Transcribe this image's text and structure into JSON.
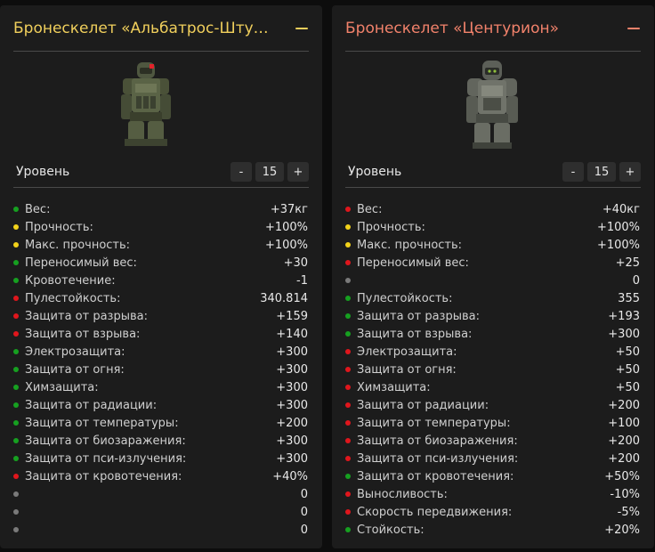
{
  "cards": [
    {
      "title": "Бронескелет «Альбатрос-Шту…",
      "level_label": "Уровень",
      "level_minus": "-",
      "level_value": "15",
      "level_plus": "+",
      "stats": [
        {
          "name": "Вес:",
          "value": "+37кг",
          "status": "green"
        },
        {
          "name": "Прочность:",
          "value": "+100%",
          "status": "yellow"
        },
        {
          "name": "Макс. прочность:",
          "value": "+100%",
          "status": "yellow"
        },
        {
          "name": "Переносимый вес:",
          "value": "+30",
          "status": "green"
        },
        {
          "name": "Кровотечение:",
          "value": "-1",
          "status": "green"
        },
        {
          "name": "Пулестойкость:",
          "value": "340.814",
          "status": "red"
        },
        {
          "name": "Защита от разрыва:",
          "value": "+159",
          "status": "red"
        },
        {
          "name": "Защита от взрыва:",
          "value": "+140",
          "status": "red"
        },
        {
          "name": "Электрозащита:",
          "value": "+300",
          "status": "green"
        },
        {
          "name": "Защита от огня:",
          "value": "+300",
          "status": "green"
        },
        {
          "name": "Химзащита:",
          "value": "+300",
          "status": "green"
        },
        {
          "name": "Защита от радиации:",
          "value": "+300",
          "status": "green"
        },
        {
          "name": "Защита от температуры:",
          "value": "+200",
          "status": "green"
        },
        {
          "name": "Защита от биозаражения:",
          "value": "+300",
          "status": "green"
        },
        {
          "name": "Защита от пси-излучения:",
          "value": "+300",
          "status": "green"
        },
        {
          "name": "Защита от кровотечения:",
          "value": "+40%",
          "status": "red"
        },
        {
          "name": "",
          "value": "0",
          "status": "gray"
        },
        {
          "name": "",
          "value": "0",
          "status": "gray"
        },
        {
          "name": "",
          "value": "0",
          "status": "gray"
        }
      ]
    },
    {
      "title": "Бронескелет «Центурион»",
      "level_label": "Уровень",
      "level_minus": "-",
      "level_value": "15",
      "level_plus": "+",
      "stats": [
        {
          "name": "Вес:",
          "value": "+40кг",
          "status": "red"
        },
        {
          "name": "Прочность:",
          "value": "+100%",
          "status": "yellow"
        },
        {
          "name": "Макс. прочность:",
          "value": "+100%",
          "status": "yellow"
        },
        {
          "name": "Переносимый вес:",
          "value": "+25",
          "status": "red"
        },
        {
          "name": "",
          "value": "0",
          "status": "gray"
        },
        {
          "name": "Пулестойкость:",
          "value": "355",
          "status": "green"
        },
        {
          "name": "Защита от разрыва:",
          "value": "+193",
          "status": "green"
        },
        {
          "name": "Защита от взрыва:",
          "value": "+300",
          "status": "green"
        },
        {
          "name": "Электрозащита:",
          "value": "+50",
          "status": "red"
        },
        {
          "name": "Защита от огня:",
          "value": "+50",
          "status": "red"
        },
        {
          "name": "Химзащита:",
          "value": "+50",
          "status": "red"
        },
        {
          "name": "Защита от радиации:",
          "value": "+200",
          "status": "red"
        },
        {
          "name": "Защита от температуры:",
          "value": "+100",
          "status": "red"
        },
        {
          "name": "Защита от биозаражения:",
          "value": "+200",
          "status": "red"
        },
        {
          "name": "Защита от пси-излучения:",
          "value": "+200",
          "status": "red"
        },
        {
          "name": "Защита от кровотечения:",
          "value": "+50%",
          "status": "green"
        },
        {
          "name": "Выносливость:",
          "value": "-10%",
          "status": "red"
        },
        {
          "name": "Скорость передвижения:",
          "value": "-5%",
          "status": "red"
        },
        {
          "name": "Стойкость:",
          "value": "+20%",
          "status": "green"
        }
      ]
    }
  ],
  "colors": {
    "left_accent": "#f0cf5c",
    "right_accent": "#f2826b",
    "green": "#16a020",
    "yellow": "#f2d21a",
    "red": "#e0161c",
    "gray": "#7a7a7a"
  },
  "icons": {
    "collapse": "minus-icon",
    "armor_left": "armor-exoskeleton-albatross-image",
    "armor_right": "armor-exoskeleton-centurion-image"
  }
}
